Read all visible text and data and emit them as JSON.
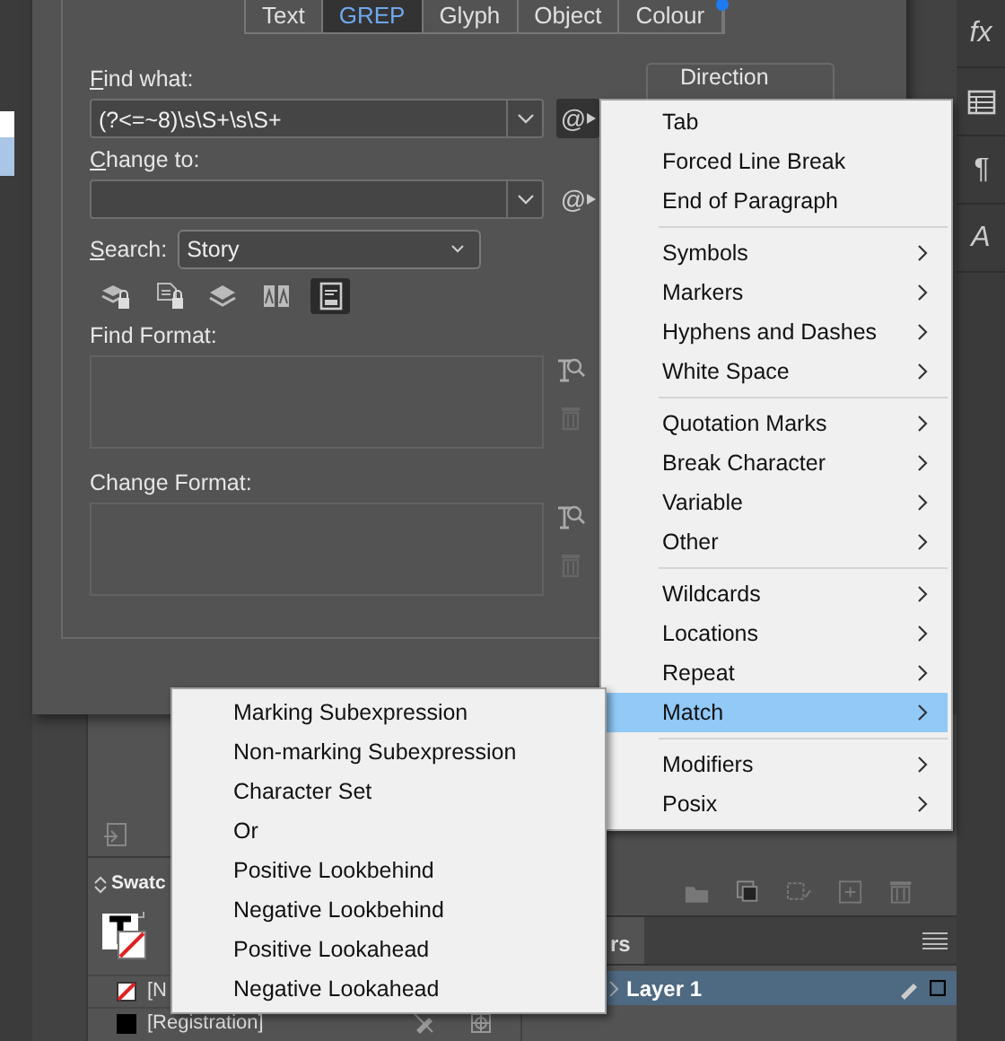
{
  "tabs": [
    {
      "label": "Text",
      "selected": false
    },
    {
      "label": "GREP",
      "selected": true
    },
    {
      "label": "Glyph",
      "selected": false
    },
    {
      "label": "Object",
      "selected": false
    },
    {
      "label": "Colour",
      "selected": false
    }
  ],
  "find_what": {
    "label": "Find what:",
    "value": "(?<=~8)\\s\\S+\\s\\S+",
    "special_button": "@",
    "special_active": true
  },
  "change_to": {
    "label": "Change to:",
    "special_button": "@",
    "special_active": false
  },
  "direction": {
    "label": "Direction"
  },
  "search": {
    "label": "Search:",
    "value": "Story"
  },
  "search_options": [
    {
      "kind": "locked-layers",
      "selected": false
    },
    {
      "kind": "locked-stories",
      "selected": false
    },
    {
      "kind": "hidden-layers",
      "selected": false
    },
    {
      "kind": "master-pages",
      "selected": false
    },
    {
      "kind": "footnotes",
      "selected": true
    }
  ],
  "find_format": {
    "label": "Find Format:"
  },
  "change_format": {
    "label": "Change Format:"
  },
  "special_menu": {
    "groups": [
      [
        {
          "label": "Tab",
          "submenu": false,
          "selected": false
        },
        {
          "label": "Forced Line Break",
          "submenu": false,
          "selected": false
        },
        {
          "label": "End of Paragraph",
          "submenu": false,
          "selected": false
        }
      ],
      [
        {
          "label": "Symbols",
          "submenu": true,
          "selected": false
        },
        {
          "label": "Markers",
          "submenu": true,
          "selected": false
        },
        {
          "label": "Hyphens and Dashes",
          "submenu": true,
          "selected": false
        },
        {
          "label": "White Space",
          "submenu": true,
          "selected": false
        }
      ],
      [
        {
          "label": "Quotation Marks",
          "submenu": true,
          "selected": false
        },
        {
          "label": "Break Character",
          "submenu": true,
          "selected": false
        },
        {
          "label": "Variable",
          "submenu": true,
          "selected": false
        },
        {
          "label": "Other",
          "submenu": true,
          "selected": false
        }
      ],
      [
        {
          "label": "Wildcards",
          "submenu": true,
          "selected": false
        },
        {
          "label": "Locations",
          "submenu": true,
          "selected": false
        },
        {
          "label": "Repeat",
          "submenu": true,
          "selected": false
        },
        {
          "label": "Match",
          "submenu": true,
          "selected": true
        }
      ],
      [
        {
          "label": "Modifiers",
          "submenu": true,
          "selected": false
        },
        {
          "label": "Posix",
          "submenu": true,
          "selected": false
        }
      ]
    ]
  },
  "submenu": {
    "items": [
      {
        "label": "Marking Subexpression"
      },
      {
        "label": "Non-marking Subexpression"
      },
      {
        "label": "Character Set"
      },
      {
        "label": "Or"
      },
      {
        "label": "Positive Lookbehind"
      },
      {
        "label": "Negative Lookbehind"
      },
      {
        "label": "Positive Lookahead"
      },
      {
        "label": "Negative Lookahead"
      }
    ]
  },
  "swatches_panel": {
    "title": "Swatc",
    "swatches": [
      {
        "name": "[N",
        "kind": "none"
      },
      {
        "name": "[Registration]",
        "kind": "registration"
      }
    ]
  },
  "layers_panel": {
    "tab": "rs",
    "layers": [
      {
        "name": "Layer 1",
        "selected": true
      }
    ]
  },
  "right_toolbar": [
    {
      "kind": "text",
      "label": "fx"
    },
    {
      "kind": "table"
    },
    {
      "kind": "text",
      "label": "¶"
    },
    {
      "kind": "text",
      "label": "A"
    }
  ]
}
